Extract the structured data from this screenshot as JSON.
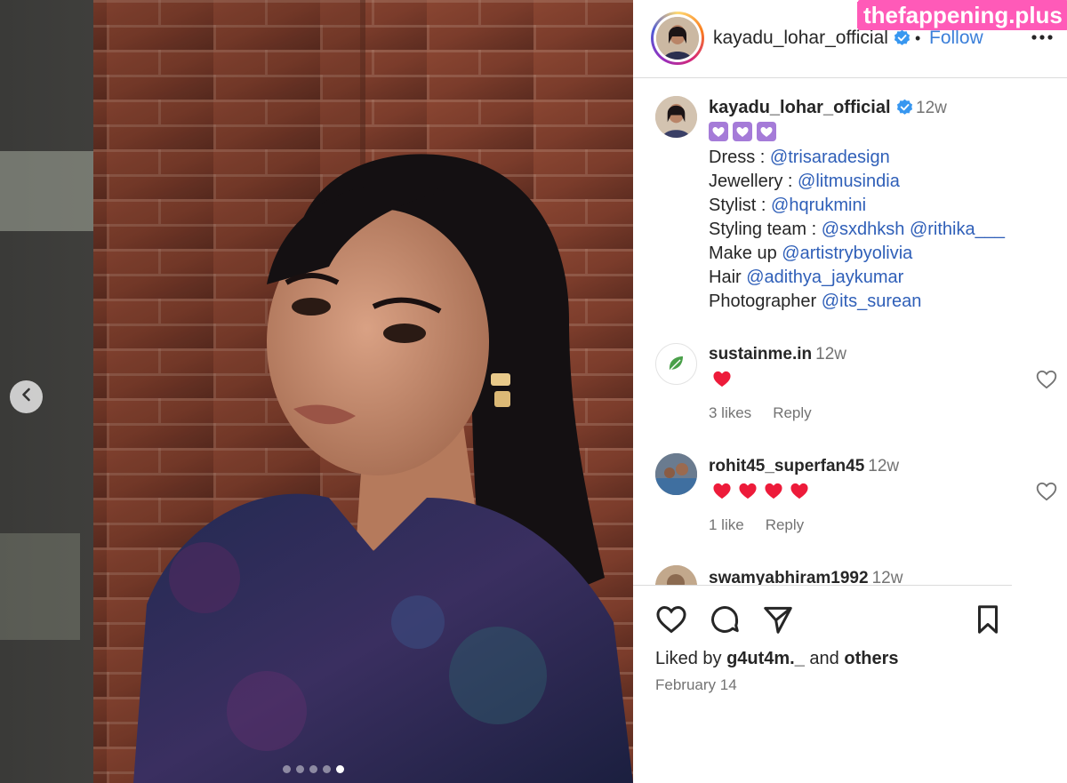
{
  "header": {
    "username": "kayadu_lohar_official",
    "separator": "•",
    "follow_label": "Follow",
    "watermark": "thefappening.plus"
  },
  "caption": {
    "username": "kayadu_lohar_official",
    "time": "12w",
    "emoji_count": 3,
    "lines": [
      {
        "label": "Dress : ",
        "mentions": [
          "@trisaradesign"
        ]
      },
      {
        "label": "Jewellery : ",
        "mentions": [
          "@litmusindia"
        ]
      },
      {
        "label": "Stylist : ",
        "mentions": [
          "@hqrukmini"
        ]
      },
      {
        "label": "Styling team : ",
        "mentions": [
          "@sxdhksh",
          "@rithika___"
        ]
      },
      {
        "label": "Make up ",
        "mentions": [
          "@artistrybyolivia"
        ]
      },
      {
        "label": "Hair ",
        "mentions": [
          "@adithya_jaykumar"
        ]
      },
      {
        "label": "Photographer ",
        "mentions": [
          "@its_surean"
        ]
      }
    ]
  },
  "comments": [
    {
      "username": "sustainme.in",
      "time": "12w",
      "hearts": 1,
      "likes": "3 likes",
      "reply": "Reply"
    },
    {
      "username": "rohit45_superfan45",
      "time": "12w",
      "hearts": 4,
      "likes": "1 like",
      "reply": "Reply"
    },
    {
      "username": "swamyabhiram1992",
      "time": "12w",
      "hearts": 0,
      "likes": "",
      "reply": ""
    }
  ],
  "footer": {
    "liked_by_prefix": "Liked by ",
    "liked_by_user": "g4ut4m._",
    "liked_by_and": " and ",
    "liked_by_others": "others",
    "date": "February 14"
  },
  "carousel": {
    "dot_count": 5,
    "active_index": 4
  },
  "colors": {
    "link": "#2f5fb8",
    "follow": "#3b7fd9",
    "watermark": "#ff5ab8",
    "heart": "#ed1b3a",
    "purple_heart": "#a57bd8"
  },
  "icons": [
    "chevron-left-icon",
    "verified-badge-icon",
    "more-options-icon",
    "heart-outline-icon",
    "comment-icon",
    "share-icon",
    "bookmark-icon"
  ]
}
